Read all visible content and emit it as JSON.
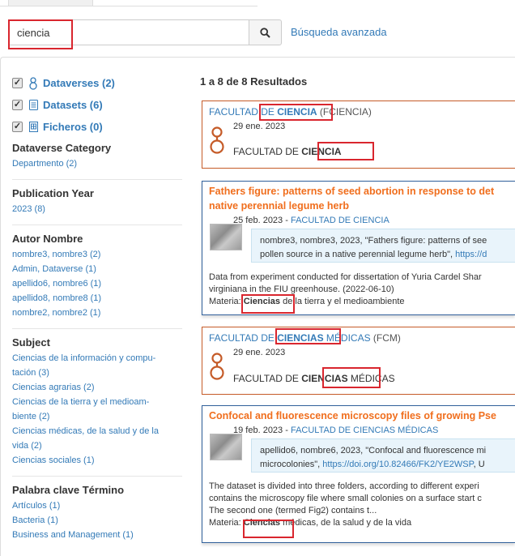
{
  "search": {
    "value": "ciencia",
    "advanced_label": "Búsqueda avanzada",
    "button_icon": "search-icon"
  },
  "facets": {
    "types": [
      {
        "label": "Dataverses (2)",
        "icon": "dataverse-icon",
        "checked": true
      },
      {
        "label": "Datasets (6)",
        "icon": "dataset-icon",
        "checked": true
      },
      {
        "label": "Ficheros (0)",
        "icon": "file-icon",
        "checked": true
      }
    ],
    "dataverse_category": {
      "title": "Dataverse Category",
      "items": [
        "Departmento (2)"
      ]
    },
    "publication_year": {
      "title": "Publication Year",
      "items": [
        "2023 (8)"
      ]
    },
    "autor": {
      "title": "Autor Nombre",
      "items": [
        "nombre3, nombre3 (2)",
        "Admin, Dataverse (1)",
        "apellido6, nombre6 (1)",
        "apellido8, nombre8 (1)",
        "nombre2, nombre2 (1)"
      ]
    },
    "subject": {
      "title": "Subject",
      "items": [
        "Ciencias de la información y compu-",
        "tación (3)",
        "Ciencias agrarias (2)",
        "Ciencias de la tierra y el medioam-",
        "biente (2)",
        "Ciencias médicas, de la salud y de la",
        "vida (2)",
        "Ciencias sociales (1)"
      ]
    },
    "palabra": {
      "title": "Palabra clave Término",
      "items": [
        "Artículos (1)",
        "Bacteria (1)",
        "Business and Management (1)"
      ]
    }
  },
  "results": {
    "count_label": "1 a 8 de 8 Resultados",
    "r1": {
      "pre": "FACULTAD DE ",
      "match": "CIENCIA",
      "suffix": " (FCIENCIA)",
      "date": "29 ene. 2023",
      "desc_pre": "FACULTAD DE ",
      "desc_match": "CIENCIA",
      "desc_post": ""
    },
    "r2": {
      "title_l1": "Fathers figure: patterns of seed abortion in response to det",
      "title_l2": "native perennial legume herb",
      "date": "25 feb. 2023",
      "sep": " - ",
      "parent": "FACULTAD DE CIENCIA",
      "cite_l1": "nombre3, nombre3, 2023, \"Fathers figure: patterns of see",
      "cite_l2_pre": "pollen source in a native perennial legume herb\", ",
      "cite_l2_doi": "https://d",
      "body_l1": "Data from experiment conducted for dissertation of Yuria Cardel Shar",
      "body_l2": "virginiana in the FIU greenhouse. (2022-06-10)",
      "materia_label": "Materia: ",
      "materia_match": "Ciencias",
      "materia_post": " de la tierra y el medioambiente"
    },
    "r3": {
      "pre": "FACULTAD DE ",
      "match": "CIENCIAS",
      "suffix": " MÉDICAS",
      "abbr": " (FCM)",
      "date": "29 ene. 2023",
      "desc_pre": "FACULTAD DE ",
      "desc_match": "CIENCIAS",
      "desc_post": " MÉDICAS"
    },
    "r4": {
      "title_l1": "Confocal and fluorescence microscopy files of growing Pse",
      "date": "19 feb. 2023",
      "sep": " - ",
      "parent": "FACULTAD DE CIENCIAS MÉDICAS",
      "cite_l1": "apellido6, nombre6, 2023, \"Confocal and fluorescence mi",
      "cite_l2_pre": "microcolonies\", ",
      "cite_l2_doi": "https://doi.org/10.82466/FK2/YE2WSP",
      "cite_l2_post": ", U",
      "body_l1": "The dataset is divided into three folders, according to different experi",
      "body_l2": "contains the microscopy file where small colonies on a surface start c",
      "body_l3": "The second one (termed Fig2) contains t...",
      "materia_label": "Materia: ",
      "materia_match": "Ciencias",
      "materia_post": " médicas, de la salud y de la vida"
    }
  },
  "colors": {
    "link": "#337ab7",
    "dataverse": "#c55b28",
    "dataset": "#f06e1d",
    "highlight": "#d9262e"
  }
}
